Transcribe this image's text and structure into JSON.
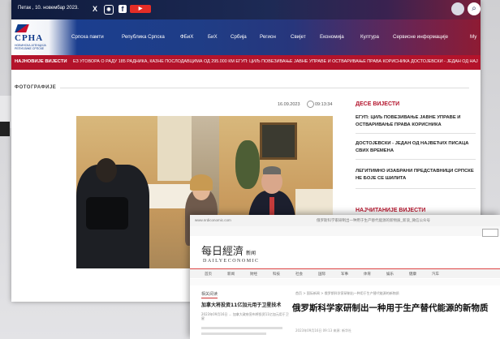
{
  "top_bar": {
    "date": "Петак , 10. новембар 2023.",
    "social": [
      "X",
      "Instagram",
      "Facebook",
      "YouTube"
    ],
    "icons": [
      "x-icon",
      "instagram-icon",
      "facebook-icon",
      "youtube-icon",
      "search-icon"
    ]
  },
  "logo": {
    "name": "СРНА",
    "subtitle": "НОВИНСКА АГЕНЦИЈА РЕПУБЛИКЕ СРПСКЕ"
  },
  "nav": {
    "items": [
      "Српска памти",
      "Република Српска",
      "ФБиХ",
      "БиХ",
      "Србија",
      "Регион",
      "Свијет",
      "Економија",
      "Култура",
      "Сервисне информације",
      "Му"
    ]
  },
  "ticker": {
    "label": "НАЈНОВИЈЕ ВИЈЕСТИ",
    "text": "ЕЗ УГОВОРА О РАДУ 185 РАДНИКА, КАЗНЕ ПОСЛОДАВЦИМА ОД 295.000 КМ    ЕГУП: ЦИЉ ПОВЕЗИВАЊЕ ЈАВНЕ УПРАВЕ И ОСТВАРИВАЊЕ ПРАВА КОРИСНИКА    ДОСТОЈЕВСКИ - ЈЕДАН ОД НАЈ"
  },
  "section": {
    "title": "ФОТОГРАФИЈЕ"
  },
  "article_meta": {
    "date": "16.09.2023",
    "time": "09:13:34"
  },
  "sidebar": {
    "title": "ДЕСЕ ВИЈЕСТИ",
    "items": [
      "ЕГУП: ЦИЉ ПОВЕЗИВАЊЕ ЈАВНЕ УПРАВЕ И ОСТВАРИВАЊЕ ПРАВА КОРИСНИКА",
      "ДОСТОЈЕВСКИ - ЈЕДАН ОД НАЈВЕЋИХ ПИСАЦА СВИХ ВРЕМЕНА",
      "ЛЕГИТИМНО ИЗАБРАНИ ПРЕДСТАВНИЦИ СРПСКЕ НЕ БОЈЕ СЕ ШИЛИТА"
    ],
    "title2": "НАЈЧИТАНИЈЕ ВИЈЕСТИ"
  },
  "colors": {
    "brand_red": "#b3132b",
    "brand_blue": "#1f3d86"
  },
  "window2": {
    "url_left": "www.nrdiconomic.com",
    "url_right": "俄罗斯科学家研制出一种用于生产替代能源的新物质_新浪_微信公众号",
    "logo_cn": "每日經濟",
    "logo_badge": "新闻",
    "logo_en": "DAILYECONOMIC",
    "nav_items": [
      "首页",
      "新闻",
      "财经",
      "科技",
      "社会",
      "国际",
      "军事",
      "体育",
      "娱乐",
      "健康",
      "汽车"
    ],
    "left_section": "相关阅读",
    "left_headline": "加拿大将投资11亿加元用于卫星技术",
    "left_sub": "2023年09月16日 ... 加拿大政府宣布将投资11亿加元用于卫星",
    "crumb": "首页 > 国际新闻 > 俄罗斯科学家研制出一种用于生产替代能源的新物质",
    "title": "俄罗斯科学家研制出一种用于生产替代能源的新物质",
    "meta": "2023年09月16日 09:13   来源: 新华社"
  }
}
